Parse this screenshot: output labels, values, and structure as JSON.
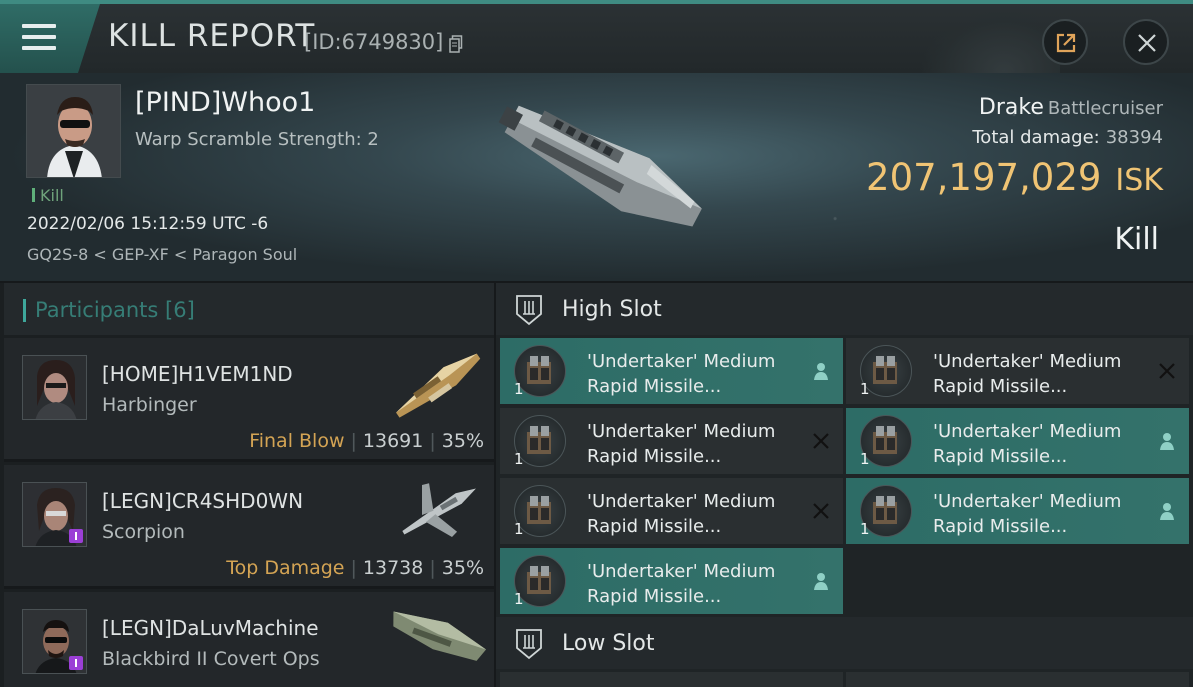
{
  "header": {
    "title": "KILL REPORT",
    "report_id": "[ID:6749830]"
  },
  "victim": {
    "name": "[PIND]Whoo1",
    "scram_strength": "Warp Scramble Strength: 2",
    "kill_tag": "Kill",
    "date": "2022/02/06 15:12:59 UTC -6",
    "location": "GQ2S-8 < GEP-XF < Paragon Soul",
    "ship": "Drake",
    "ship_class": "Battlecruiser",
    "total_damage_label": "Total damage:",
    "total_damage": "38394",
    "isk_value": "207,197,029",
    "isk_unit": "ISK",
    "result": "Kill"
  },
  "participants": {
    "label": "Participants",
    "count": "[6]",
    "rows": [
      {
        "name": "[HOME]H1VEM1ND",
        "ship": "Harbinger",
        "tag": "Final Blow",
        "damage": "13691",
        "percent": "35%",
        "has_badge": false
      },
      {
        "name": "[LEGN]CR4SHD0WN",
        "ship": "Scorpion",
        "tag": "Top Damage",
        "damage": "13738",
        "percent": "35%",
        "has_badge": true
      },
      {
        "name": "[LEGN]DaLuvMachine",
        "ship": "Blackbird II Covert Ops",
        "has_badge": true
      }
    ]
  },
  "fitting": {
    "high_slot_label": "High Slot",
    "low_slot_label": "Low Slot",
    "high_modules": [
      {
        "name_line1": "'Undertaker' Medium",
        "name_line2": "Rapid Missile...",
        "qty": "1",
        "state": "fitted"
      },
      {
        "name_line1": "'Undertaker' Medium",
        "name_line2": "Rapid Missile...",
        "qty": "1",
        "state": "destroyed"
      },
      {
        "name_line1": "'Undertaker' Medium",
        "name_line2": "Rapid Missile...",
        "qty": "1",
        "state": "destroyed"
      },
      {
        "name_line1": "'Undertaker' Medium",
        "name_line2": "Rapid Missile...",
        "qty": "1",
        "state": "fitted"
      },
      {
        "name_line1": "'Undertaker' Medium",
        "name_line2": "Rapid Missile...",
        "qty": "1",
        "state": "destroyed"
      },
      {
        "name_line1": "'Undertaker' Medium",
        "name_line2": "Rapid Missile...",
        "qty": "1",
        "state": "fitted"
      },
      {
        "name_line1": "'Undertaker' Medium",
        "name_line2": "Rapid Missile...",
        "qty": "1",
        "state": "fitted"
      }
    ]
  },
  "colors": {
    "accent": "#3ea79b",
    "isk_gold": "#f0c474",
    "fitted_bg": "#2d6c66",
    "final_blow": "#d4a454"
  },
  "icons": [
    "menu-icon",
    "copy-icon",
    "share-icon",
    "close-icon",
    "slot-icon",
    "pilot-icon",
    "destroyed-x-icon"
  ]
}
